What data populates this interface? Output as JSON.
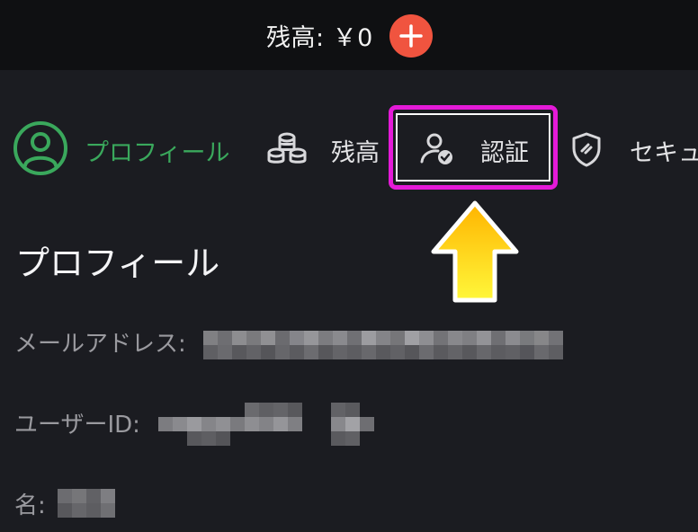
{
  "header": {
    "balance_label": "残高: ￥0",
    "add_button_icon": "plus-icon",
    "add_button_color": "#f0543f"
  },
  "tabs": [
    {
      "label": "プロフィール",
      "icon": "user-circle-icon",
      "active": true
    },
    {
      "label": "残高",
      "icon": "coins-stack-icon",
      "active": false
    },
    {
      "label": "認証",
      "icon": "user-verified-icon",
      "active": false
    },
    {
      "label": "セキュ",
      "icon": "shield-icon",
      "active": false
    }
  ],
  "colors": {
    "active": "#3aa85c",
    "highlight": "#e41ad8",
    "arrow": "#ffd200",
    "background": "#1b1c21",
    "topbar": "#0f1012"
  },
  "profile": {
    "title": "プロフィール",
    "email_label": "メールアドレス:",
    "user_id_label": "ユーザーID:",
    "name_label": "名:"
  }
}
